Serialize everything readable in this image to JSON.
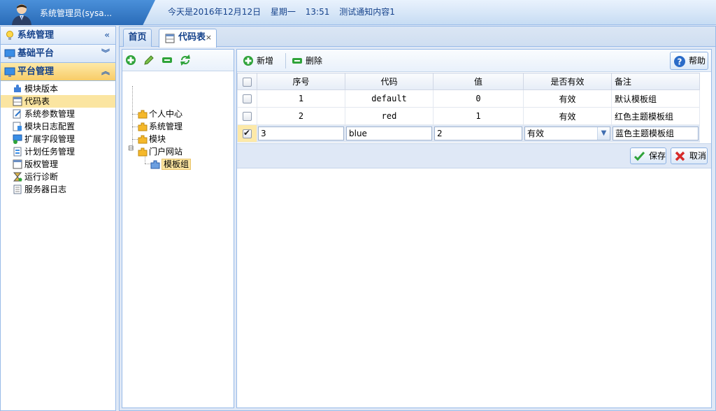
{
  "header": {
    "user": "系统管理员(sysa...",
    "date_text": "今天是2016年12月12日",
    "weekday": "星期一",
    "time": "13:51",
    "notice": "测试通知内容1"
  },
  "sidebar": {
    "sections": [
      {
        "title": "系统管理",
        "tool": "«"
      },
      {
        "title": "基础平台",
        "tool": "︾"
      },
      {
        "title": "平台管理",
        "tool": "︽"
      }
    ],
    "items": [
      {
        "label": "模块版本"
      },
      {
        "label": "代码表"
      },
      {
        "label": "系统参数管理"
      },
      {
        "label": "模块日志配置"
      },
      {
        "label": "扩展字段管理"
      },
      {
        "label": "计划任务管理"
      },
      {
        "label": "版权管理"
      },
      {
        "label": "运行诊断"
      },
      {
        "label": "服务器日志"
      }
    ]
  },
  "tabs": {
    "home": "首页",
    "code_table": "代码表",
    "close": "×"
  },
  "tree": {
    "nodes": [
      "个人中心",
      "系统管理",
      "模块",
      "门户网站",
      "模板组"
    ],
    "collapse": "⊟"
  },
  "grid_toolbar": {
    "add": "新增",
    "delete": "删除",
    "help": "帮助"
  },
  "grid": {
    "columns": [
      "序号",
      "代码",
      "值",
      "是否有效",
      "备注"
    ],
    "rows": [
      {
        "seq": "1",
        "code": "default",
        "value": "0",
        "valid": "有效",
        "note": "默认模板组"
      },
      {
        "seq": "2",
        "code": "red",
        "value": "1",
        "valid": "有效",
        "note": "红色主题模板组"
      }
    ],
    "edit_row": {
      "seq": "3",
      "code": "blue",
      "value": "2",
      "valid": "有效",
      "note": "蓝色主题模板组"
    }
  },
  "edit_actions": {
    "save": "保存",
    "cancel": "取消"
  },
  "colors": {
    "accent": "#15428b",
    "selected": "#fbe5a1",
    "border": "#99bbe8"
  }
}
